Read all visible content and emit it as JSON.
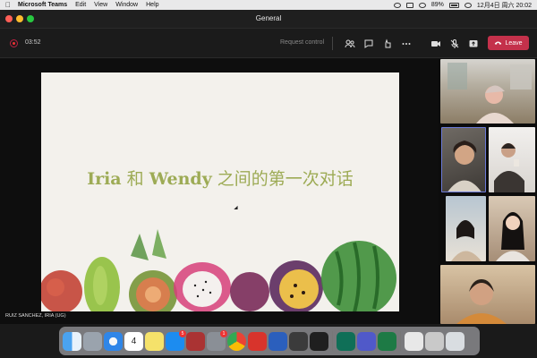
{
  "menubar": {
    "app_name": "Microsoft Teams",
    "items": [
      "Edit",
      "View",
      "Window",
      "Help"
    ],
    "battery": "89%",
    "datetime": "12月4日 周六  20:02"
  },
  "window": {
    "title": "General"
  },
  "meeting": {
    "timer": "03:52",
    "request_control": "Request control",
    "leave_label": "Leave"
  },
  "slide": {
    "title_part1": "Iria",
    "title_part2": " 和 ",
    "title_part3": "Wendy",
    "title_part4": " 之间的第一次对话"
  },
  "presenter": {
    "name": "RUIZ SANCHEZ, IRIA (UG)"
  },
  "dock": {
    "calendar_day": "4",
    "badges": {
      "appstore": "5",
      "settings": "1"
    }
  },
  "colors": {
    "leave": "#c4314b",
    "title_green": "#9dab55",
    "active_tile_border": "#6b7ad8"
  },
  "icons": [
    "people-icon",
    "chat-icon",
    "reactions-icon",
    "more-icon",
    "camera-icon",
    "mic-off-icon",
    "share-icon",
    "phone-icon"
  ]
}
